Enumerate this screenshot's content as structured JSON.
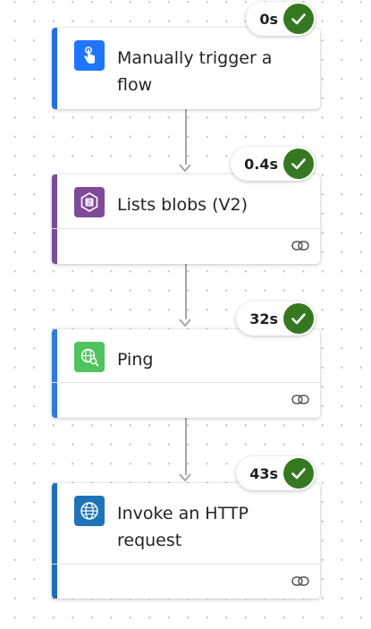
{
  "flow": {
    "steps": [
      {
        "title": "Manually trigger a flow",
        "duration": "0s",
        "status": "succeeded",
        "icon": "touch-hand-icon",
        "accent": "#1f6fe5",
        "icon_bg": "#1f75fe"
      },
      {
        "title": "Lists blobs (V2)",
        "duration": "0.4s",
        "status": "succeeded",
        "icon": "blob-storage-icon",
        "accent": "#7b4d96",
        "icon_bg": "#804998"
      },
      {
        "title": "Ping",
        "duration": "32s",
        "status": "succeeded",
        "icon": "globe-search-icon",
        "accent": "#2d7be0",
        "icon_bg": "#4fc35d"
      },
      {
        "title": "Invoke an HTTP request",
        "duration": "43s",
        "status": "succeeded",
        "icon": "globe-icon",
        "accent": "#1d6fb8",
        "icon_bg": "#1f73b7"
      }
    ]
  },
  "colors": {
    "success": "#36781f",
    "connector": "#a7a7a7",
    "canvas_dots": "#c8c8c8"
  }
}
